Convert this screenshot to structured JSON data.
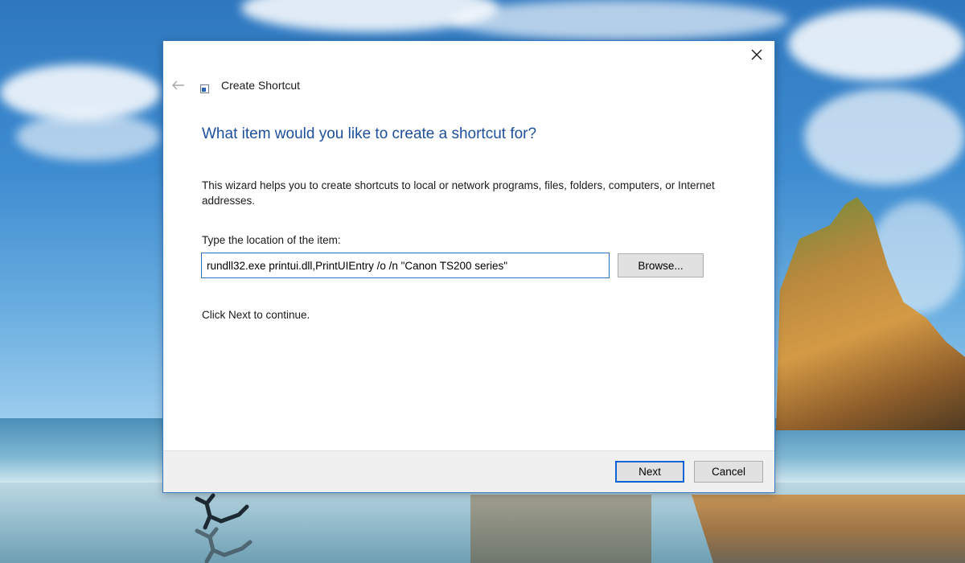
{
  "dialog": {
    "title": "Create Shortcut",
    "heading": "What item would you like to create a shortcut for?",
    "description": "This wizard helps you to create shortcuts to local or network programs, files, folders, computers, or Internet addresses.",
    "location_label": "Type the location of the item:",
    "location_value": "rundll32.exe printui.dll,PrintUIEntry /o /n \"Canon TS200 series\"",
    "browse_label": "Browse...",
    "continue_text": "Click Next to continue.",
    "next_label": "Next",
    "cancel_label": "Cancel"
  },
  "icons": {
    "back": "back-arrow-icon",
    "close": "close-icon",
    "app": "shortcut-app-icon"
  },
  "colors": {
    "accent": "#0a64d3",
    "heading": "#1e4f9b",
    "dialog_border": "#3a78c2"
  }
}
